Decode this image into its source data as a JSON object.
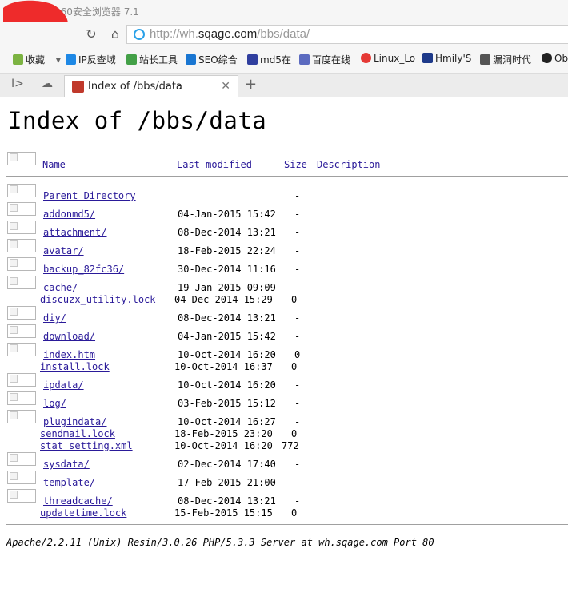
{
  "browser": {
    "window_title": "360安全浏览器 7.1",
    "url_prefix": "http://wh.",
    "url_domain": "sqage.com",
    "url_path": "/bbs/data/",
    "tab_title": "Index of /bbs/data",
    "bookmarks": [
      "收藏",
      "IP反查域",
      "站长工具",
      "SEO综合",
      "md5在",
      "百度在线",
      "Linux_Lo",
      "Hmily'S",
      "漏洞时代",
      "Ob"
    ],
    "bookmark_colors": [
      "#7cb342",
      "#1e88e5",
      "#43a047",
      "#1976d2",
      "#303f9f",
      "#5c6bc0",
      "#e53935",
      "#1e3a8a",
      "#555555",
      "#222222"
    ]
  },
  "page": {
    "heading": "Index of /bbs/data",
    "columns": {
      "name": "Name",
      "modified": "Last modified",
      "size": "Size",
      "description": "Description"
    },
    "entries": [
      {
        "name": "Parent Directory",
        "modified": "",
        "size": "-",
        "icon": true
      },
      {
        "name": "addonmd5/",
        "modified": "04-Jan-2015 15:42",
        "size": "-",
        "icon": true
      },
      {
        "name": "attachment/",
        "modified": "08-Dec-2014 13:21",
        "size": "-",
        "icon": true
      },
      {
        "name": "avatar/",
        "modified": "18-Feb-2015 22:24",
        "size": "-",
        "icon": true
      },
      {
        "name": "backup_82fc36/",
        "modified": "30-Dec-2014 11:16",
        "size": "-",
        "icon": true
      },
      {
        "name": "cache/",
        "modified": "19-Jan-2015 09:09",
        "size": "-",
        "icon": true
      },
      {
        "name": "discuzx_utility.lock",
        "modified": "04-Dec-2014 15:29",
        "size": "0",
        "icon": false
      },
      {
        "name": "diy/",
        "modified": "08-Dec-2014 13:21",
        "size": "-",
        "icon": true
      },
      {
        "name": "download/",
        "modified": "04-Jan-2015 15:42",
        "size": "-",
        "icon": true
      },
      {
        "name": "index.htm",
        "modified": "10-Oct-2014 16:20",
        "size": "0",
        "icon": true
      },
      {
        "name": "install.lock",
        "modified": "10-Oct-2014 16:37",
        "size": "0",
        "icon": false
      },
      {
        "name": "ipdata/",
        "modified": "10-Oct-2014 16:20",
        "size": "-",
        "icon": true
      },
      {
        "name": "log/",
        "modified": "03-Feb-2015 15:12",
        "size": "-",
        "icon": true
      },
      {
        "name": "plugindata/",
        "modified": "10-Oct-2014 16:27",
        "size": "-",
        "icon": true
      },
      {
        "name": "sendmail.lock",
        "modified": "18-Feb-2015 23:20",
        "size": "0",
        "icon": false
      },
      {
        "name": "stat_setting.xml",
        "modified": "10-Oct-2014 16:20",
        "size": "772",
        "icon": false
      },
      {
        "name": "sysdata/",
        "modified": "02-Dec-2014 17:40",
        "size": "-",
        "icon": true
      },
      {
        "name": "template/",
        "modified": "17-Feb-2015 21:00",
        "size": "-",
        "icon": true
      },
      {
        "name": "threadcache/",
        "modified": "08-Dec-2014 13:21",
        "size": "-",
        "icon": true
      },
      {
        "name": "updatetime.lock",
        "modified": "15-Feb-2015 15:15",
        "size": "0",
        "icon": false
      }
    ],
    "footer": "Apache/2.2.11 (Unix) Resin/3.0.26 PHP/5.3.3 Server at wh.sqage.com Port 80"
  }
}
